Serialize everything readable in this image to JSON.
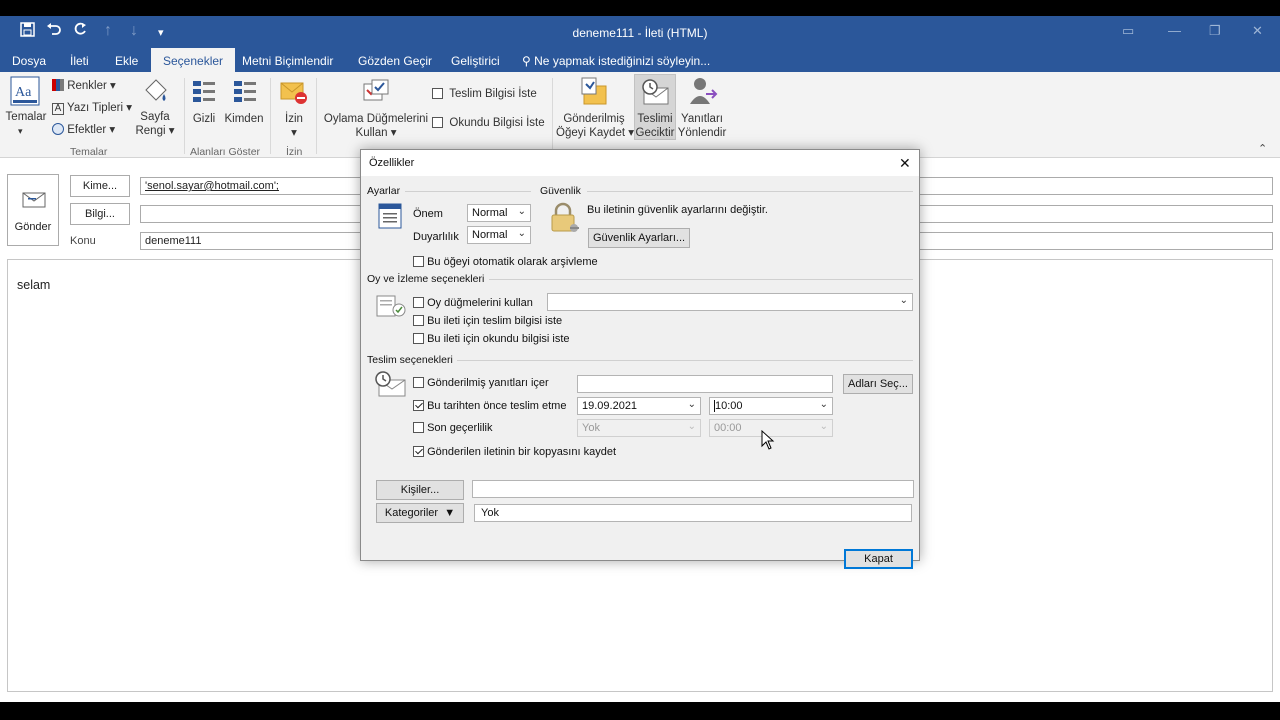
{
  "window": {
    "title": "deneme111 - İleti (HTML)",
    "tabs": [
      "Dosya",
      "İleti",
      "Ekle",
      "Seçenekler",
      "Metni Biçimlendir",
      "Gözden Geçir",
      "Geliştirici"
    ],
    "active_tab": "Seçenekler",
    "tell_me": "Ne yapmak istediğinizi söyleyin...",
    "accent": "#2b579a"
  },
  "ribbon": {
    "temalar": "Temalar",
    "renkler": "Renkler",
    "yazi_tipleri": "Yazı Tipleri",
    "efektler": "Efektler",
    "sayfa_rengi_1": "Sayfa",
    "sayfa_rengi_2": "Rengi",
    "group_temalar": "Temalar",
    "gizli": "Gizli",
    "kimden": "Kimden",
    "group_alanlari": "Alanları Göster",
    "izin": "İzin",
    "group_izin": "İzin",
    "oylama_1": "Oylama Düğmelerini",
    "oylama_2": "Kullan",
    "teslim_bilgisi": "Teslim Bilgisi İste",
    "okundu_bilgisi": "Okundu Bilgisi İste",
    "gonderilmis_1": "Gönderilmiş",
    "gonderilmis_2": "Öğeyi Kaydet",
    "teslimi_1": "Teslimi",
    "teslimi_2": "Geciktir",
    "yanitlari_1": "Yanıtları",
    "yanitlari_2": "Yönlendir"
  },
  "compose": {
    "send": "Gönder",
    "to_btn": "Kime...",
    "to_value": "'senol.sayar@hotmail.com';",
    "cc_btn": "Bilgi...",
    "subject_label": "Konu",
    "subject_value": "deneme111",
    "body": "selam"
  },
  "dialog": {
    "title": "Özellikler",
    "ayarlar": "Ayarlar",
    "onem_label": "Önem",
    "onem_value": "Normal",
    "duyarlilik_label": "Duyarlılık",
    "duyarlilik_value": "Normal",
    "guvenlik": "Güvenlik",
    "guvenlik_text": "Bu iletinin güvenlik ayarlarını değiştir.",
    "guvenlik_btn": "Güvenlik Ayarları...",
    "arsiv": "Bu öğeyi otomatik olarak arşivleme",
    "oy_section": "Oy ve İzleme seçenekleri",
    "oy_dugmeleri": "Oy düğmelerini kullan",
    "teslim_bilgisi": "Bu ileti için teslim bilgisi iste",
    "okundu_bilgisi": "Bu ileti için okundu bilgisi iste",
    "teslim_section": "Teslim seçenekleri",
    "gonderilmis_yanitlar": "Gönderilmiş yanıtları içer",
    "adlari_sec": "Adları Seç...",
    "tarihten_once": "Bu tarihten önce teslim etme",
    "date_value": "19.09.2021",
    "time_value": "10:00",
    "son_gecerlilik": "Son geçerlilik",
    "yok_date": "Yok",
    "yok_time": "00:00",
    "kopya": "Gönderilen iletinin bir kopyasını kaydet",
    "kisiler_btn": "Kişiler...",
    "kategoriler_btn": "Kategoriler",
    "kategoriler_value": "Yok",
    "kapat_btn": "Kapat"
  }
}
